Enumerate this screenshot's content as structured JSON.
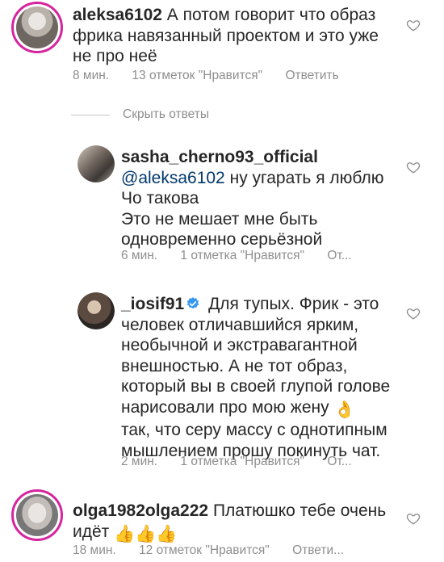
{
  "comments": [
    {
      "username": "aleksa6102",
      "text": "А потом говорит что образ фрика навязанный проектом и это уже не про неё",
      "lines": [
        "А потом говорит что образ",
        "фрика навязанный проектом и это уже",
        "не про неё"
      ],
      "time": "8 мин.",
      "likes": "13 отметок \"Нравится\"",
      "reply": "Ответить"
    },
    {
      "username": "sasha_cherno93_official",
      "mention": "@aleksa6102",
      "lines": [
        "ну угарать я люблю",
        "Чо такова",
        "Это не мешает мне быть",
        "одновременно серьёзной"
      ],
      "time": "6 мин.",
      "likes": "1 отметка \"Нравится\"",
      "reply": "От..."
    },
    {
      "username": "_iosif91",
      "lines": [
        "Для тупых. Фрик - это",
        "человек отличавшийся ярким,",
        "необычной и экстравагантной",
        "внешностью. А не тот образ,",
        "который вы в своей глупой голове",
        "нарисовали про мою жену",
        "так, что серу массу с однотипным",
        "мышлением прошу покинуть чат."
      ],
      "emoji": "👌",
      "time": "2 мин.",
      "likes": "1 отметка \"Нравится\"",
      "reply": "От..."
    },
    {
      "username": "olga1982olga222",
      "lines": [
        "Платюшко тебе очень",
        "идёт"
      ],
      "emoji": "👍👍👍",
      "time": "18 мин.",
      "likes": "12 отметок \"Нравится\"",
      "reply": "Ответи..."
    }
  ],
  "hide_replies": "Скрыть ответы",
  "colors": {
    "ring": "#d6249f",
    "meta": "#8e8e8e",
    "mention": "#00376b",
    "verified": "#3897f0"
  },
  "icons": [
    "heart-icon",
    "verified-badge-icon"
  ]
}
